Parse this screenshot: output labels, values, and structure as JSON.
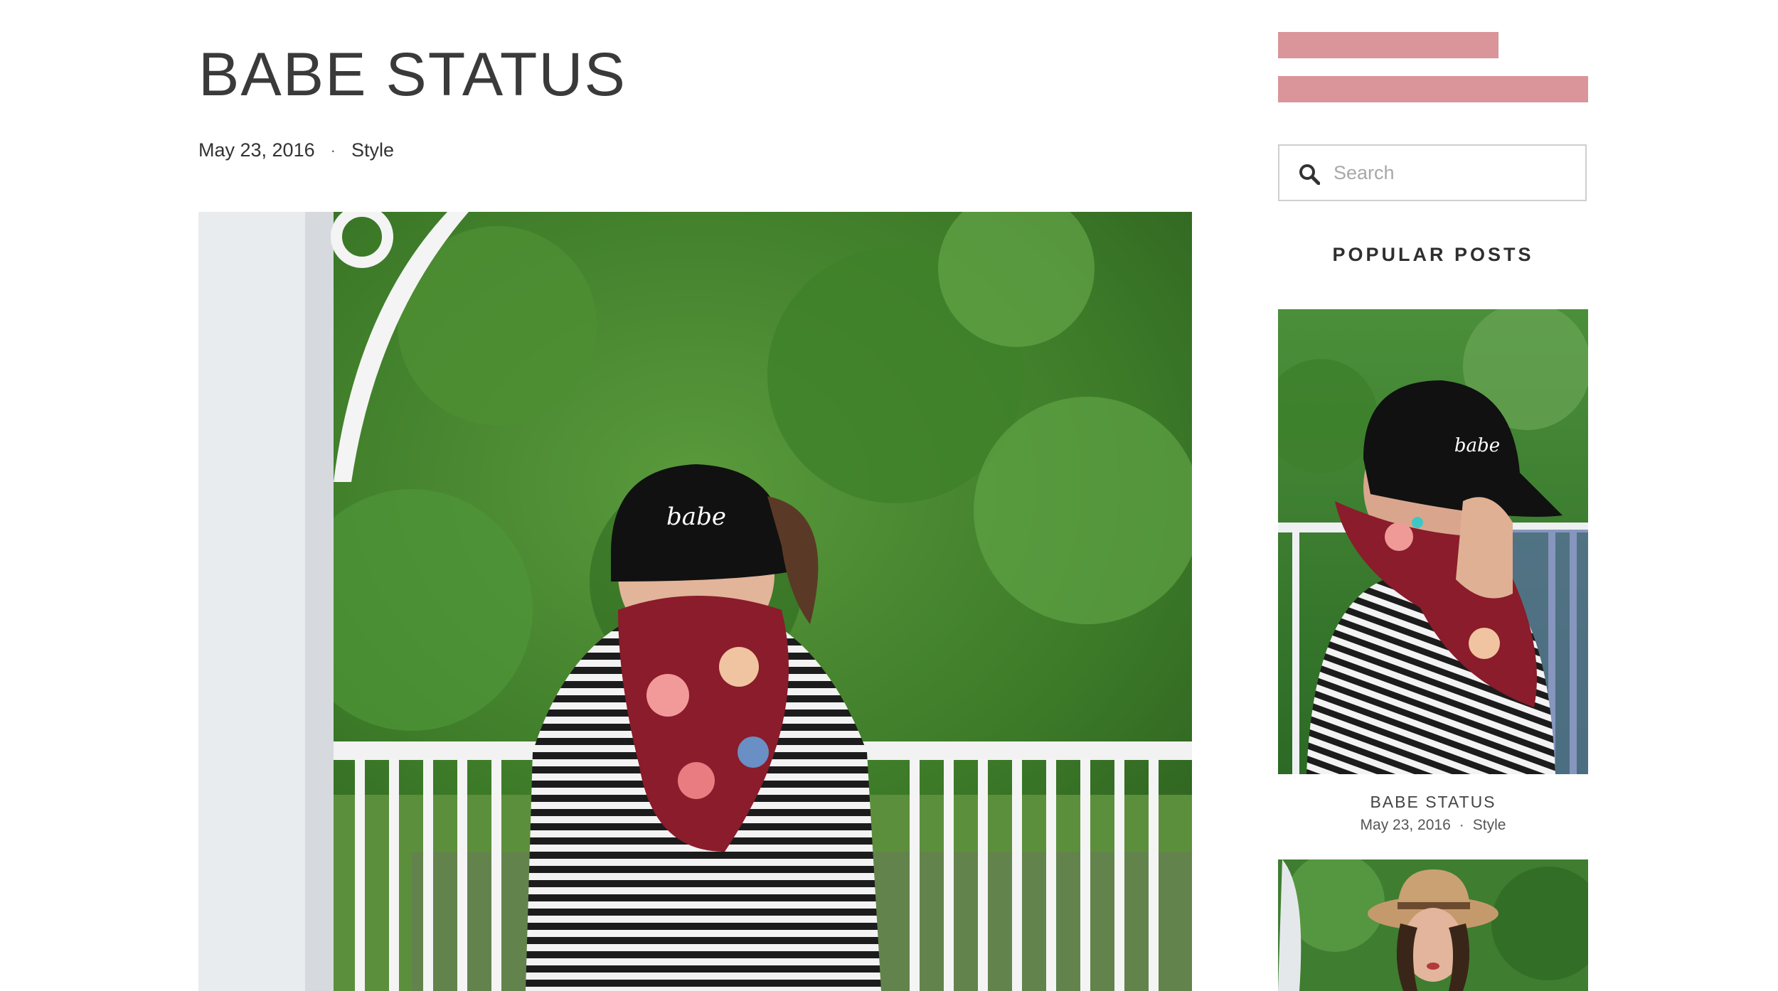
{
  "post": {
    "title": "BABE STATUS",
    "date": "May 23, 2016",
    "separator": "·",
    "category": "Style"
  },
  "sidebar": {
    "search": {
      "placeholder": "Search",
      "icon": "search-icon"
    },
    "popular_heading": "POPULAR POSTS",
    "popular_posts": [
      {
        "title": "BABE STATUS",
        "date": "May 23, 2016",
        "separator": "·",
        "category": "Style"
      }
    ]
  },
  "colors": {
    "accent_pink": "#d9959a",
    "text": "#333333",
    "border": "#cfcfcf"
  }
}
